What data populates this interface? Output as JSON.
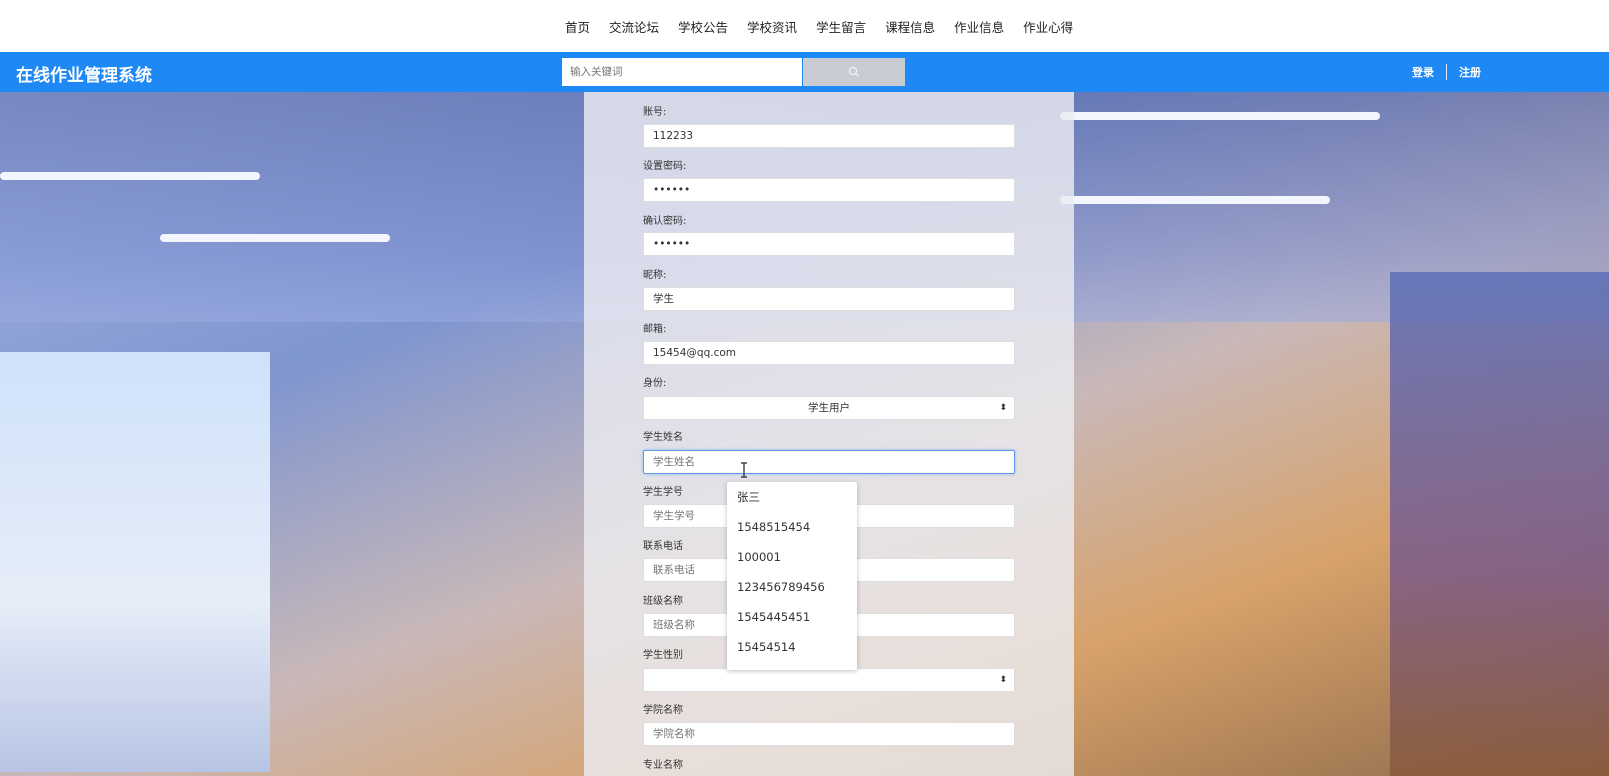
{
  "topnav": {
    "items": [
      "首页",
      "交流论坛",
      "学校公告",
      "学校资讯",
      "学生留言",
      "课程信息",
      "作业信息",
      "作业心得"
    ]
  },
  "header": {
    "logo": "在线作业管理系统",
    "search_placeholder": "输入关键词",
    "login": "登录",
    "register": "注册",
    "accent_color": "#1e88f5"
  },
  "form": {
    "account_label": "账号:",
    "account_value": "112233",
    "password_label": "设置密码:",
    "password_value": "••••••",
    "confirm_label": "确认密码:",
    "confirm_value": "••••••",
    "nickname_label": "昵称:",
    "nickname_value": "学生",
    "email_label": "邮箱:",
    "email_value": "15454@qq.com",
    "role_label": "身份:",
    "role_value": "学生用户",
    "student_name_label": "学生姓名",
    "student_name_placeholder": "学生姓名",
    "student_no_label": "学生学号",
    "student_no_placeholder": "学生学号",
    "phone_label": "联系电话",
    "phone_placeholder": "联系电话",
    "class_label": "班级名称",
    "class_placeholder": "班级名称",
    "gender_label": "学生性别",
    "gender_value": "",
    "college_label": "学院名称",
    "college_placeholder": "学院名称",
    "major_label": "专业名称"
  },
  "autocomplete": {
    "options": [
      "张三",
      "1548515454",
      "100001",
      "123456789456",
      "1545445451",
      "15454514"
    ]
  }
}
